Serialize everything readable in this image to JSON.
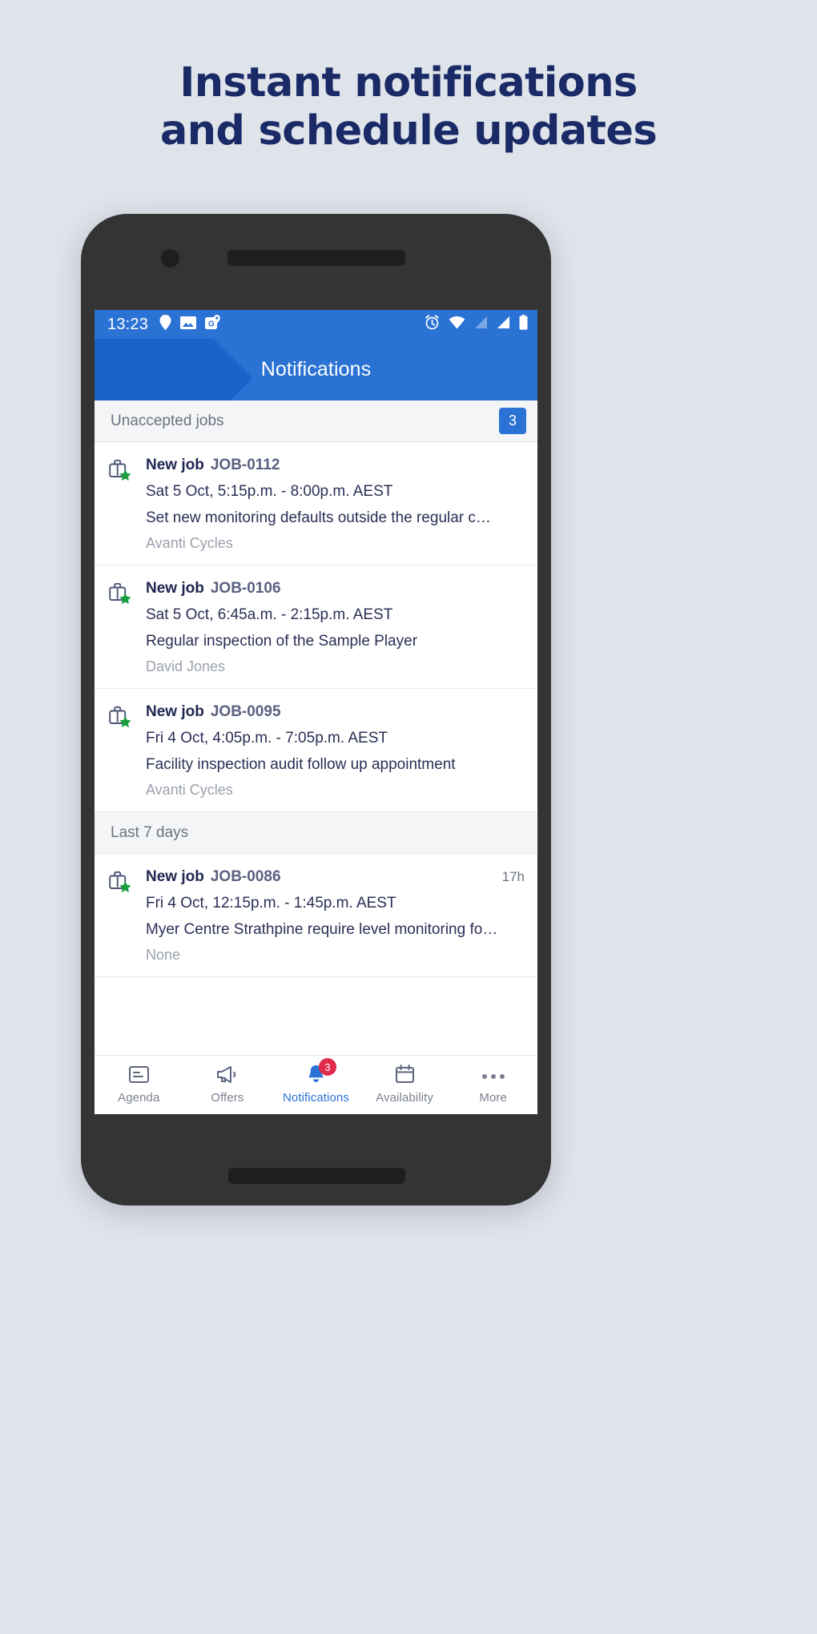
{
  "promo": {
    "line1": "Instant notifications",
    "line2": "and schedule updates",
    "color": "#1a2a66"
  },
  "theme": {
    "background": "#dfe3ea",
    "phone_body": "#343434",
    "primary_blue": "#2a72d4",
    "app_bar_shade": "#1a63c8",
    "badge_red": "#e02b4d",
    "star_green": "#1a9e3f"
  },
  "status_bar": {
    "time": "13:23",
    "left_icons": [
      "location-pin-icon",
      "image-icon",
      "map-pin-icon"
    ],
    "right_icons": [
      "alarm-icon",
      "wifi-icon",
      "signal-dim-icon",
      "signal-icon",
      "battery-icon"
    ]
  },
  "app_bar": {
    "title": "Notifications"
  },
  "sections": [
    {
      "label": "Unaccepted jobs",
      "badge": "3",
      "items": [
        {
          "icon": "briefcase-star-icon",
          "title": "New job",
          "reference": "JOB-0112",
          "age": "",
          "time": "Sat 5 Oct, 5:15p.m. - 8:00p.m. AEST",
          "description": "Set new monitoring defaults outside the regular c…",
          "subtitle": "Avanti Cycles"
        },
        {
          "icon": "briefcase-star-icon",
          "title": "New job",
          "reference": "JOB-0106",
          "age": "",
          "time": "Sat 5 Oct, 6:45a.m. - 2:15p.m. AEST",
          "description": "Regular inspection of the Sample Player",
          "subtitle": "David Jones"
        },
        {
          "icon": "briefcase-star-icon",
          "title": "New job",
          "reference": "JOB-0095",
          "age": "",
          "time": "Fri 4 Oct, 4:05p.m. - 7:05p.m. AEST",
          "description": "Facility inspection audit follow up appointment",
          "subtitle": "Avanti Cycles"
        }
      ]
    },
    {
      "label": "Last 7 days",
      "badge": "",
      "items": [
        {
          "icon": "briefcase-star-icon",
          "title": "New job",
          "reference": "JOB-0086",
          "age": "17h",
          "time": "Fri 4 Oct, 12:15p.m. - 1:45p.m. AEST",
          "description": "Myer Centre Strathpine require level monitoring fo…",
          "subtitle": "None"
        }
      ]
    }
  ],
  "bottom_nav": {
    "items": [
      {
        "label": "Agenda",
        "icon": "agenda-icon",
        "badge": "",
        "active": false
      },
      {
        "label": "Offers",
        "icon": "megaphone-icon",
        "badge": "",
        "active": false
      },
      {
        "label": "Notifications",
        "icon": "bell-icon",
        "badge": "3",
        "active": true
      },
      {
        "label": "Availability",
        "icon": "calendar-icon",
        "badge": "",
        "active": false
      },
      {
        "label": "More",
        "icon": "more-dots-icon",
        "badge": "",
        "active": false
      }
    ]
  }
}
